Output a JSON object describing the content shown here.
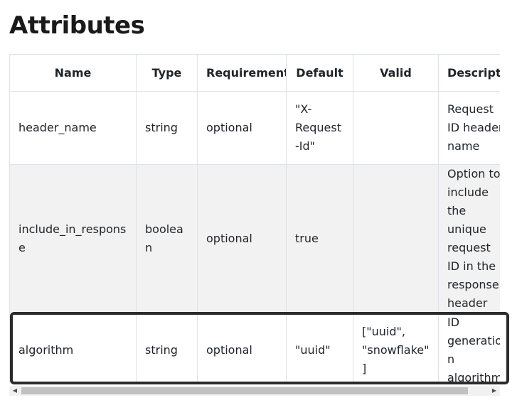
{
  "page": {
    "title": "Attributes"
  },
  "table": {
    "headers": [
      "Name",
      "Type",
      "Requirement",
      "Default",
      "Valid",
      "Descriptio"
    ],
    "rows": [
      {
        "name": "header_name",
        "type": "string",
        "requirement": "optional",
        "default": "\"X-Request-Id\"",
        "valid": "",
        "description": "Request ID header name"
      },
      {
        "name": "include_in_response",
        "type": "boolean",
        "requirement": "optional",
        "default": "true",
        "valid": "",
        "description": "Option to include the unique request ID in the response header"
      },
      {
        "name": "algorithm",
        "type": "string",
        "requirement": "optional",
        "default": "\"uuid\"",
        "valid": "[\"uuid\", \"snowflake\"]",
        "description": "ID generation algorithm"
      }
    ]
  },
  "scrollbar": {
    "left_arrow": "◀",
    "right_arrow": "▶",
    "position": 0.0
  },
  "colors": {
    "border": "#dee2e6",
    "striped_row": "#f2f2f2",
    "highlight": "#2b2b2b"
  }
}
